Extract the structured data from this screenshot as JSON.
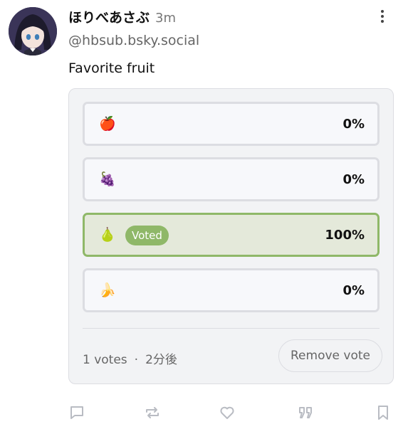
{
  "post": {
    "author_name": "ほりべあさぶ",
    "time": "3m",
    "handle": "@hbsub.bsky.social",
    "text": "Favorite fruit"
  },
  "poll": {
    "options": [
      {
        "emoji": "🍎",
        "percent": "0%",
        "voted": false
      },
      {
        "emoji": "🍇",
        "percent": "0%",
        "voted": false
      },
      {
        "emoji": "🍐",
        "percent": "100%",
        "voted": true,
        "badge": "Voted"
      },
      {
        "emoji": "🍌",
        "percent": "0%",
        "voted": false
      }
    ],
    "votes": "1 votes",
    "separator": "·",
    "deadline": "2分後",
    "remove_label": "Remove vote"
  },
  "colors": {
    "accent": "#8fb868",
    "voted_bg": "#e4e9da"
  },
  "actions": [
    "reply-icon",
    "repost-icon",
    "like-icon",
    "quote-icon",
    "bookmark-icon"
  ]
}
